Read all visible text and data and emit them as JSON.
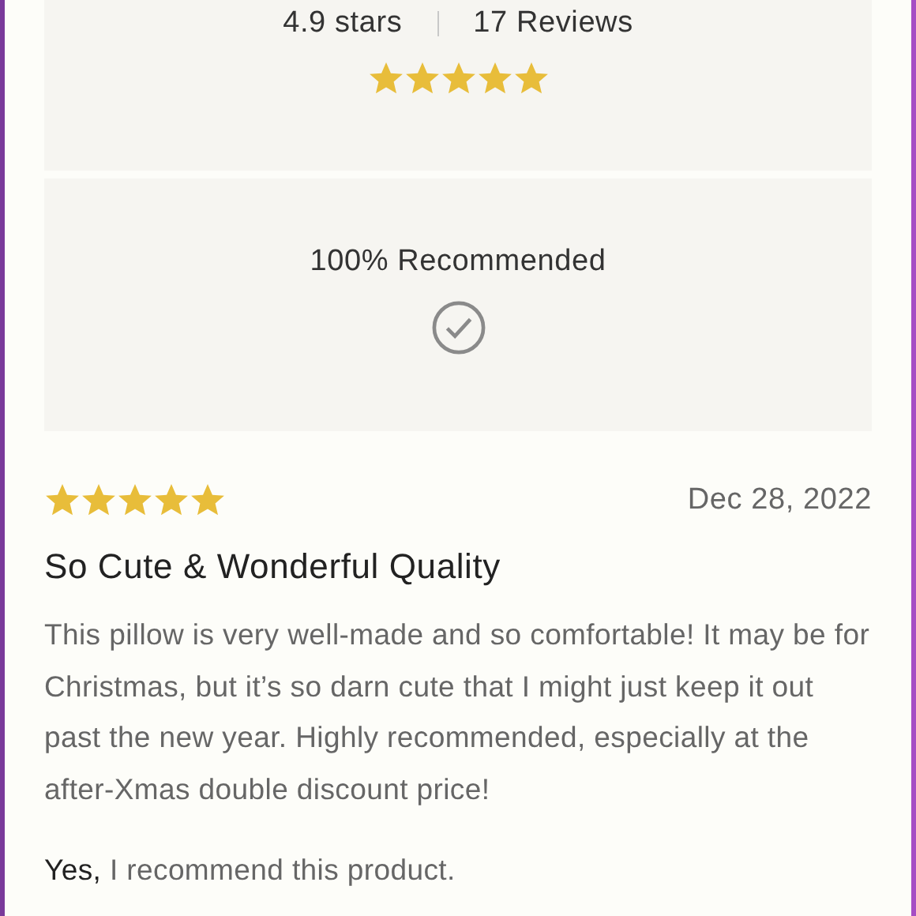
{
  "summary": {
    "rating": "4.9 stars",
    "reviews": "17 Reviews",
    "stars": 5
  },
  "recommend_panel": {
    "label": "100% Recommended"
  },
  "review": {
    "stars": 5,
    "date": "Dec 28, 2022",
    "title": "So Cute & Wonderful Quality",
    "body": "This pillow is very well-made and so comfortable! It may be for Christmas, but it’s so darn cute that I might just keep it out past the new year. Highly recommended, especially at the after-Xmas double discount price!",
    "recommendation": "**Yes,** I recommend this product."
  }
}
